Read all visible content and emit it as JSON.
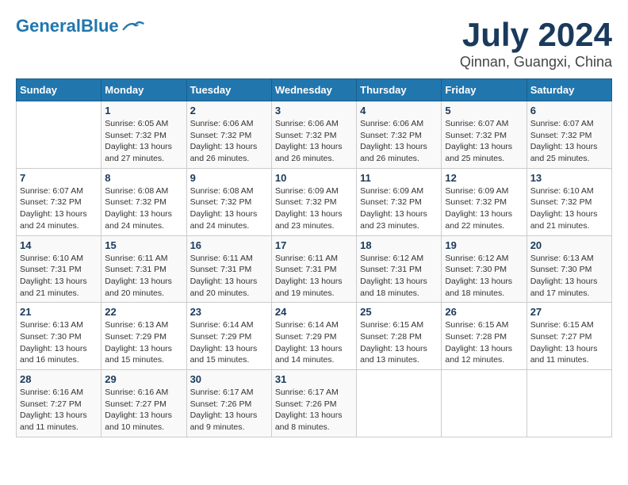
{
  "header": {
    "logo_general": "General",
    "logo_blue": "Blue",
    "title": "July 2024",
    "subtitle": "Qinnan, Guangxi, China"
  },
  "calendar": {
    "weekdays": [
      "Sunday",
      "Monday",
      "Tuesday",
      "Wednesday",
      "Thursday",
      "Friday",
      "Saturday"
    ],
    "weeks": [
      [
        {
          "day": "",
          "info": ""
        },
        {
          "day": "1",
          "info": "Sunrise: 6:05 AM\nSunset: 7:32 PM\nDaylight: 13 hours\nand 27 minutes."
        },
        {
          "day": "2",
          "info": "Sunrise: 6:06 AM\nSunset: 7:32 PM\nDaylight: 13 hours\nand 26 minutes."
        },
        {
          "day": "3",
          "info": "Sunrise: 6:06 AM\nSunset: 7:32 PM\nDaylight: 13 hours\nand 26 minutes."
        },
        {
          "day": "4",
          "info": "Sunrise: 6:06 AM\nSunset: 7:32 PM\nDaylight: 13 hours\nand 26 minutes."
        },
        {
          "day": "5",
          "info": "Sunrise: 6:07 AM\nSunset: 7:32 PM\nDaylight: 13 hours\nand 25 minutes."
        },
        {
          "day": "6",
          "info": "Sunrise: 6:07 AM\nSunset: 7:32 PM\nDaylight: 13 hours\nand 25 minutes."
        }
      ],
      [
        {
          "day": "7",
          "info": "Sunrise: 6:07 AM\nSunset: 7:32 PM\nDaylight: 13 hours\nand 24 minutes."
        },
        {
          "day": "8",
          "info": "Sunrise: 6:08 AM\nSunset: 7:32 PM\nDaylight: 13 hours\nand 24 minutes."
        },
        {
          "day": "9",
          "info": "Sunrise: 6:08 AM\nSunset: 7:32 PM\nDaylight: 13 hours\nand 24 minutes."
        },
        {
          "day": "10",
          "info": "Sunrise: 6:09 AM\nSunset: 7:32 PM\nDaylight: 13 hours\nand 23 minutes."
        },
        {
          "day": "11",
          "info": "Sunrise: 6:09 AM\nSunset: 7:32 PM\nDaylight: 13 hours\nand 23 minutes."
        },
        {
          "day": "12",
          "info": "Sunrise: 6:09 AM\nSunset: 7:32 PM\nDaylight: 13 hours\nand 22 minutes."
        },
        {
          "day": "13",
          "info": "Sunrise: 6:10 AM\nSunset: 7:32 PM\nDaylight: 13 hours\nand 21 minutes."
        }
      ],
      [
        {
          "day": "14",
          "info": "Sunrise: 6:10 AM\nSunset: 7:31 PM\nDaylight: 13 hours\nand 21 minutes."
        },
        {
          "day": "15",
          "info": "Sunrise: 6:11 AM\nSunset: 7:31 PM\nDaylight: 13 hours\nand 20 minutes."
        },
        {
          "day": "16",
          "info": "Sunrise: 6:11 AM\nSunset: 7:31 PM\nDaylight: 13 hours\nand 20 minutes."
        },
        {
          "day": "17",
          "info": "Sunrise: 6:11 AM\nSunset: 7:31 PM\nDaylight: 13 hours\nand 19 minutes."
        },
        {
          "day": "18",
          "info": "Sunrise: 6:12 AM\nSunset: 7:31 PM\nDaylight: 13 hours\nand 18 minutes."
        },
        {
          "day": "19",
          "info": "Sunrise: 6:12 AM\nSunset: 7:30 PM\nDaylight: 13 hours\nand 18 minutes."
        },
        {
          "day": "20",
          "info": "Sunrise: 6:13 AM\nSunset: 7:30 PM\nDaylight: 13 hours\nand 17 minutes."
        }
      ],
      [
        {
          "day": "21",
          "info": "Sunrise: 6:13 AM\nSunset: 7:30 PM\nDaylight: 13 hours\nand 16 minutes."
        },
        {
          "day": "22",
          "info": "Sunrise: 6:13 AM\nSunset: 7:29 PM\nDaylight: 13 hours\nand 15 minutes."
        },
        {
          "day": "23",
          "info": "Sunrise: 6:14 AM\nSunset: 7:29 PM\nDaylight: 13 hours\nand 15 minutes."
        },
        {
          "day": "24",
          "info": "Sunrise: 6:14 AM\nSunset: 7:29 PM\nDaylight: 13 hours\nand 14 minutes."
        },
        {
          "day": "25",
          "info": "Sunrise: 6:15 AM\nSunset: 7:28 PM\nDaylight: 13 hours\nand 13 minutes."
        },
        {
          "day": "26",
          "info": "Sunrise: 6:15 AM\nSunset: 7:28 PM\nDaylight: 13 hours\nand 12 minutes."
        },
        {
          "day": "27",
          "info": "Sunrise: 6:15 AM\nSunset: 7:27 PM\nDaylight: 13 hours\nand 11 minutes."
        }
      ],
      [
        {
          "day": "28",
          "info": "Sunrise: 6:16 AM\nSunset: 7:27 PM\nDaylight: 13 hours\nand 11 minutes."
        },
        {
          "day": "29",
          "info": "Sunrise: 6:16 AM\nSunset: 7:27 PM\nDaylight: 13 hours\nand 10 minutes."
        },
        {
          "day": "30",
          "info": "Sunrise: 6:17 AM\nSunset: 7:26 PM\nDaylight: 13 hours\nand 9 minutes."
        },
        {
          "day": "31",
          "info": "Sunrise: 6:17 AM\nSunset: 7:26 PM\nDaylight: 13 hours\nand 8 minutes."
        },
        {
          "day": "",
          "info": ""
        },
        {
          "day": "",
          "info": ""
        },
        {
          "day": "",
          "info": ""
        }
      ]
    ]
  }
}
